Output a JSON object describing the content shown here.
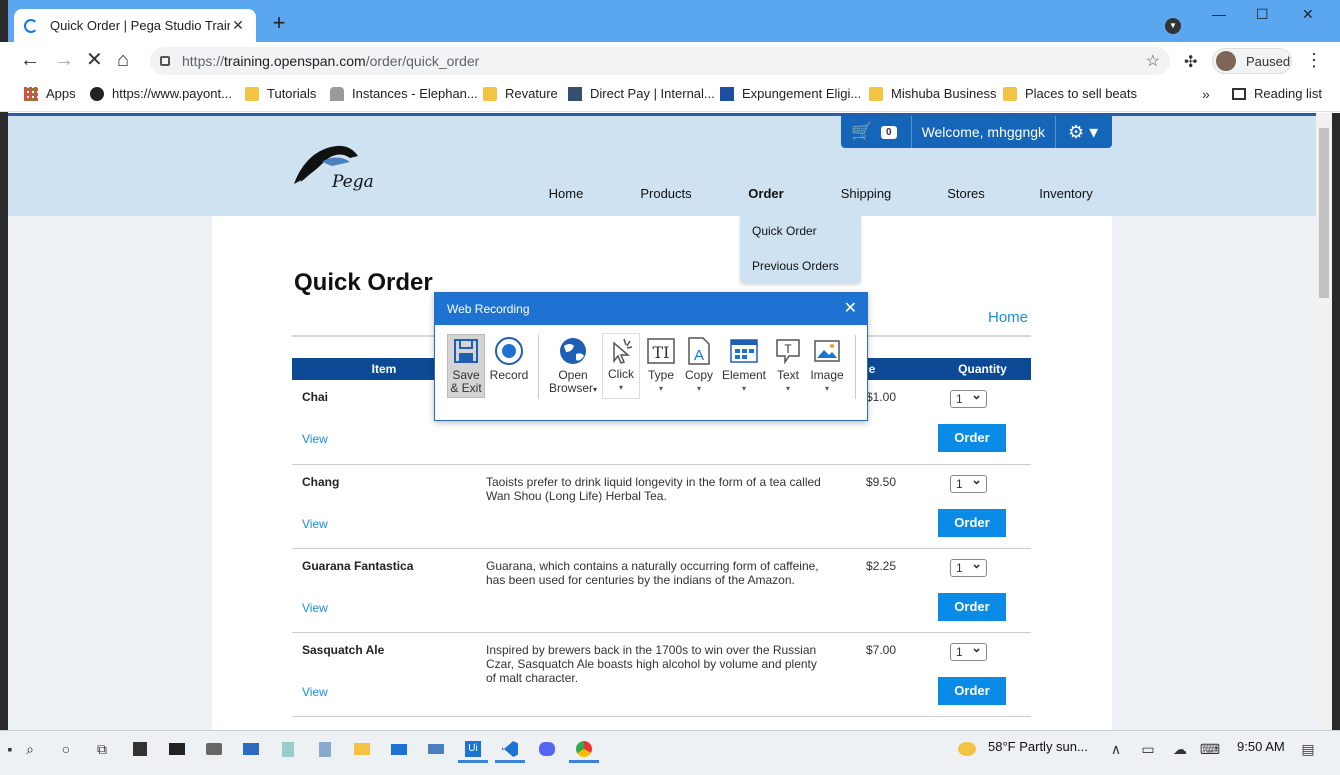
{
  "browser": {
    "tab_title": "Quick Order | Pega Studio Trainin",
    "tab_close": "✕",
    "new_tab": "+",
    "url_domain": "training.openspan.com",
    "url_scheme": "https://",
    "url_path": "/order/quick_order",
    "profile_label": "Paused",
    "bookmarks": [
      {
        "label": "Apps",
        "icon": "apps-grid-icon"
      },
      {
        "label": "https://www.payont...",
        "icon": "globe-icon"
      },
      {
        "label": "Tutorials",
        "icon": "folder-icon"
      },
      {
        "label": "Instances - Elephan...",
        "icon": "elephant-icon"
      },
      {
        "label": "Revature",
        "icon": "folder-icon"
      },
      {
        "label": "Direct Pay | Internal...",
        "icon": "irs-icon"
      },
      {
        "label": "Expungement Eligi...",
        "icon": "rg-icon"
      },
      {
        "label": "Mishuba Business",
        "icon": "folder-icon"
      },
      {
        "label": "Places to sell beats",
        "icon": "folder-icon"
      }
    ],
    "bookmarks_more": "»",
    "reading_list": "Reading list"
  },
  "site": {
    "logo_text": "Pega",
    "cart_count": "0",
    "welcome": "Welcome, mhggngk",
    "nav": [
      "Home",
      "Products",
      "Order",
      "Shipping",
      "Stores",
      "Inventory"
    ],
    "active_nav": "Order",
    "dropdown": [
      "Quick Order",
      "Previous Orders"
    ],
    "page_title": "Quick Order",
    "home_link": "Home",
    "table_headers": {
      "item": "Item",
      "price": "Price",
      "quantity": "Quantity"
    },
    "rows": [
      {
        "name": "Chai",
        "view": "View",
        "desc": "",
        "price": "$1.00",
        "qty": "1",
        "order": "Order"
      },
      {
        "name": "Chang",
        "view": "View",
        "desc": "Taoists prefer to drink liquid longevity in the form of a tea called Wan Shou (Long Life) Herbal Tea.",
        "price": "$9.50",
        "qty": "1",
        "order": "Order"
      },
      {
        "name": "Guarana Fantastica",
        "view": "View",
        "desc": "Guarana, which contains a naturally occurring form of caffeine, has been used for centuries by the indians of the Amazon.",
        "price": "$2.25",
        "qty": "1",
        "order": "Order"
      },
      {
        "name": "Sasquatch Ale",
        "view": "View",
        "desc": "Inspired by brewers back in the 1700s to win over the Russian Czar, Sasquatch Ale boasts high alcohol by volume and plenty of malt character.",
        "price": "$7.00",
        "qty": "1",
        "order": "Order"
      }
    ]
  },
  "dialog": {
    "title": "Web Recording",
    "tools": {
      "save1": "Save",
      "save2": "& Exit",
      "record": "Record",
      "open1": "Open",
      "open2": "Browser",
      "click": "Click",
      "type": "Type",
      "copy": "Copy",
      "element": "Element",
      "text": "Text",
      "image": "Image"
    }
  },
  "taskbar": {
    "weather": "58°F  Partly sun...",
    "time": "9:50 AM"
  },
  "colors": {
    "accent": "#1e73d2",
    "header_bg": "#cfe2f2",
    "order_button": "#0b8be8",
    "table_header": "#0d4a96"
  }
}
